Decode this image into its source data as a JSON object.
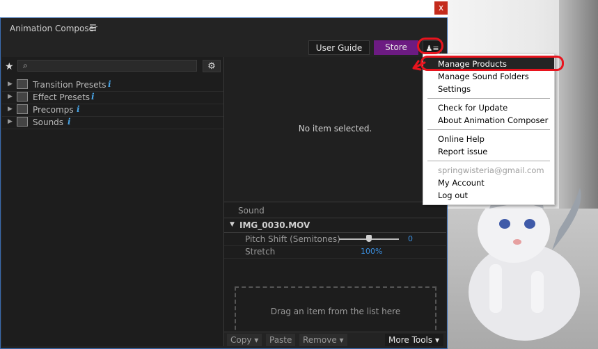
{
  "window": {
    "title": "Animation Composer",
    "close_label": "x"
  },
  "header": {
    "user_guide": "User Guide",
    "store": "Store"
  },
  "colors": {
    "store_accent": "#6c1b82",
    "link_blue": "#3b8fe0",
    "annotation_red": "#e8141e",
    "info_blue": "#49a6e9"
  },
  "search": {
    "placeholder": ""
  },
  "tree": [
    {
      "label": "Transition Presets",
      "icon": "transition-icon"
    },
    {
      "label": "Effect Presets",
      "icon": "effect-icon"
    },
    {
      "label": "Precomps",
      "icon": "precomp-icon"
    },
    {
      "label": "Sounds",
      "icon": "sound-icon"
    }
  ],
  "preview": {
    "empty_text": "No item selected."
  },
  "sound": {
    "header": "Sound",
    "file": "IMG_0030.MOV",
    "params": [
      {
        "label": "Pitch Shift (Semitones)",
        "value": "0",
        "slider_fraction": 0.5
      },
      {
        "label": "Stretch",
        "value": "100%"
      }
    ],
    "drop_text": "Drag an item from the list here"
  },
  "bottom_bar": {
    "copy": "Copy",
    "paste": "Paste",
    "remove": "Remove",
    "more_tools": "More Tools"
  },
  "menu": {
    "items": [
      "Manage Products",
      "Manage Sound Folders",
      "Settings",
      "Check for Update",
      "About Animation Composer",
      "Online Help",
      "Report issue",
      "springwisteria@gmail.com",
      "My Account",
      "Log out"
    ]
  }
}
